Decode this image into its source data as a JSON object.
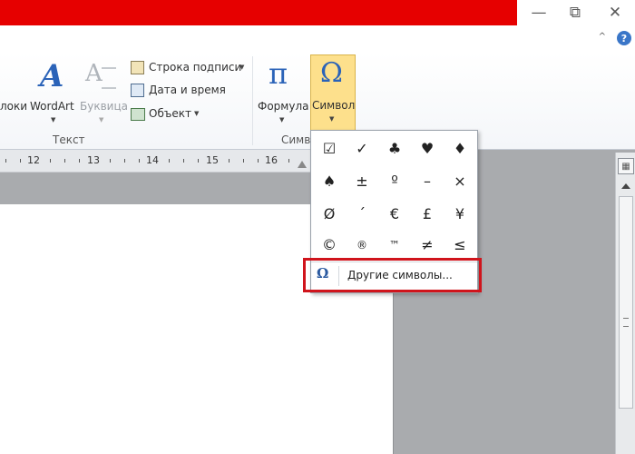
{
  "window": {
    "minimize": "—",
    "restore": "⧉",
    "close": "✕",
    "ribbon_collapse": "^",
    "help": "?"
  },
  "ribbon": {
    "text_group": {
      "label": "Текст",
      "items": [
        {
          "id": "zakladki",
          "label": "локи"
        },
        {
          "id": "wordart",
          "label": "WordArt",
          "glyph": "A"
        },
        {
          "id": "bukvica",
          "label": "Буквица",
          "glyph": "A"
        }
      ],
      "small_items": [
        {
          "label": "Строка подписи",
          "icon": "signature-line-icon"
        },
        {
          "label": "Дата и время",
          "icon": "date-time-icon"
        },
        {
          "label": "Объект",
          "icon": "object-icon"
        }
      ]
    },
    "symbols_group": {
      "label": "Симв",
      "formula_label": "Формула",
      "formula_glyph": "π",
      "symbol_label": "Символ",
      "symbol_glyph": "Ω"
    }
  },
  "ruler": {
    "numbers": [
      "12",
      "13",
      "14",
      "15",
      "16"
    ]
  },
  "dropdown": {
    "symbols": [
      "☑",
      "✓",
      "♣",
      "♥",
      "♦",
      "♠",
      "±",
      "º",
      "–",
      "×",
      "Ø",
      "´",
      "€",
      "£",
      "¥",
      "©",
      "®",
      "™",
      "≠",
      "≤"
    ],
    "other_icon": "Ω",
    "other_label": "Другие символы..."
  },
  "colors": {
    "title_bar": "#e60000",
    "highlight_border": "#d0141c",
    "symbol_button_active": "#fde08c"
  }
}
